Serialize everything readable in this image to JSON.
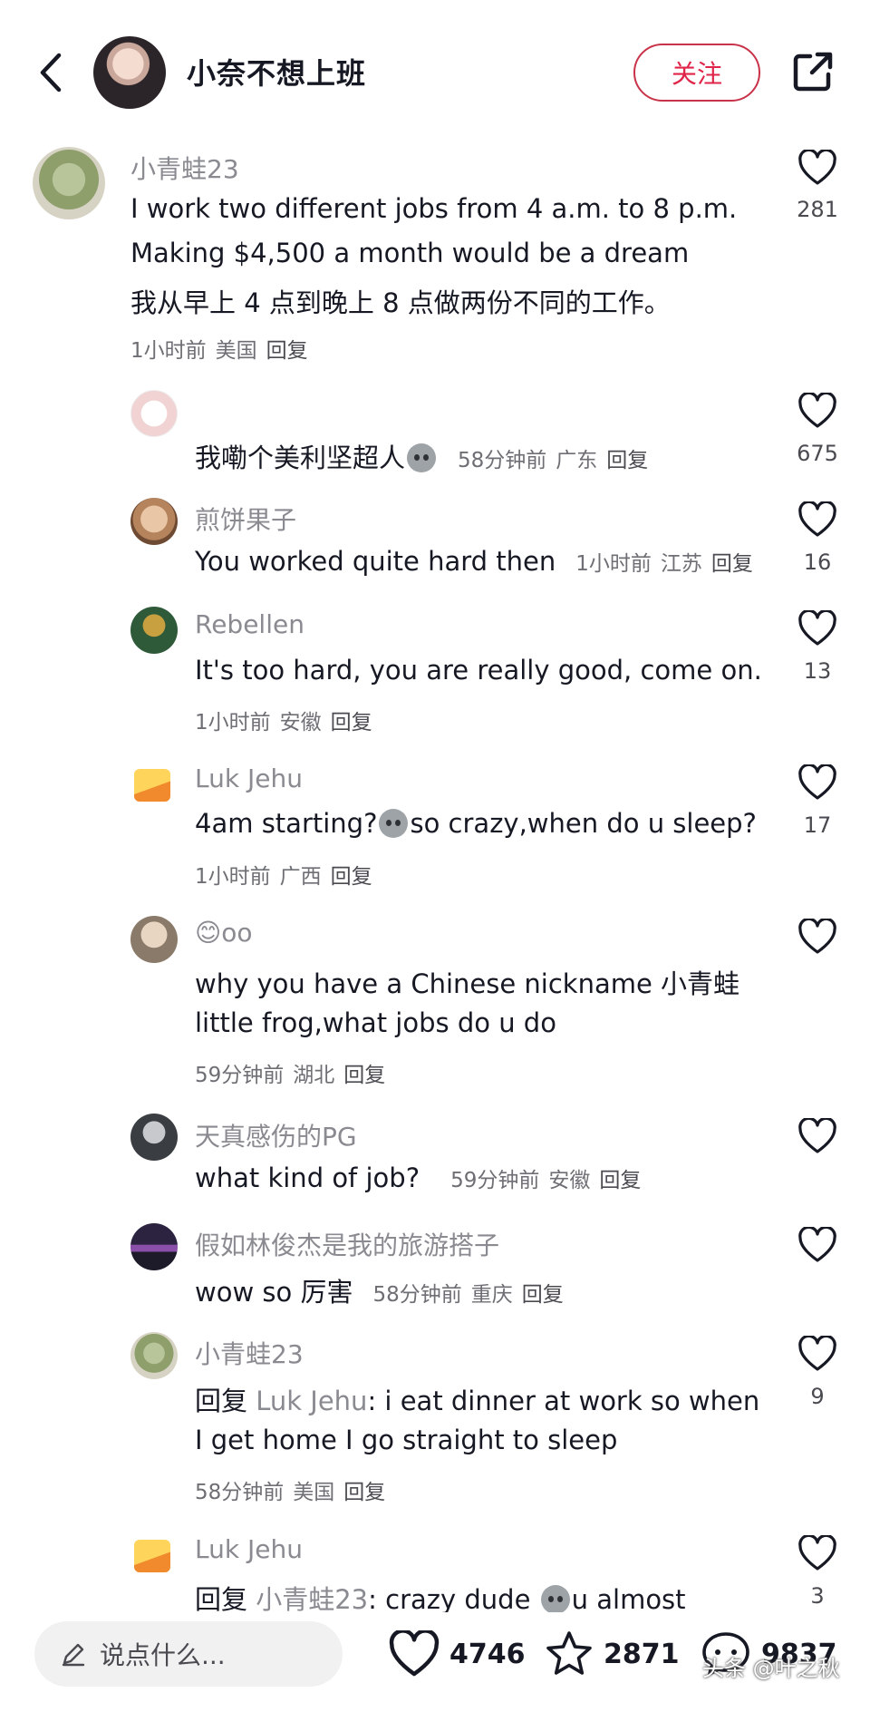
{
  "header": {
    "title": "小奈不想上班",
    "follow_label": "关注"
  },
  "comments": [
    {
      "name": "小青蛙23",
      "lines": [
        "I work two different jobs from 4 a.m. to 8 p.m.",
        "Making $4,500 a month would be a dream",
        "我从早上 4 点到晚上 8 点做两份不同的工作。"
      ],
      "time": "1小时前",
      "location": "美国",
      "reply": "回复",
      "likes": "281"
    },
    {
      "name": "",
      "text": "我嘞个美利坚超人",
      "time": "58分钟前",
      "location": "广东",
      "reply": "回复",
      "likes": "675"
    },
    {
      "name": "煎饼果子",
      "text": "You worked quite hard then",
      "time": "1小时前",
      "location": "江苏",
      "reply": "回复",
      "likes": "16"
    },
    {
      "name": "Rebellen",
      "text": "It's too hard, you are really good, come on.",
      "time": "1小时前",
      "location": "安徽",
      "reply": "回复",
      "likes": "13"
    },
    {
      "name": "Luk Jehu",
      "text_a": "4am starting?",
      "text_b": "so crazy,when do u sleep?",
      "time": "1小时前",
      "location": "广西",
      "reply": "回复",
      "likes": "17"
    },
    {
      "name": "😊oo",
      "lines": [
        "why you have a  Chinese nickname 小青蛙",
        " little frog,what jobs do u do"
      ],
      "time": "59分钟前",
      "location": "湖北",
      "reply": "回复",
      "likes": ""
    },
    {
      "name": "天真感伤的PG",
      "text": "what kind of job?",
      "time": "59分钟前",
      "location": "安徽",
      "reply": "回复",
      "likes": ""
    },
    {
      "name": "假如林俊杰是我的旅游搭子",
      "text": "wow so 厉害",
      "time": "58分钟前",
      "location": "重庆",
      "reply": "回复",
      "likes": ""
    },
    {
      "name": "小青蛙23",
      "reply_prefix": "回复",
      "reply_to": "Luk Jehu",
      "line1": ": i eat dinner at work so when",
      "line2": "I get home I go straight to sleep",
      "time": "58分钟前",
      "location": "美国",
      "reply": "回复",
      "likes": "9"
    },
    {
      "name": "Luk Jehu",
      "reply_prefix": "回复",
      "reply_to": "小青蛙23",
      "text_a": ": crazy dude",
      "text_b": "u almost",
      "likes": "3"
    }
  ],
  "bottom": {
    "input_placeholder": "说点什么...",
    "likes": "4746",
    "favorites": "2871",
    "comments": "9837",
    "watermark": "头条 @叶之秋"
  },
  "icons": {
    "back": "chevron-left-icon",
    "share": "share-external-icon",
    "like": "heart-outline-icon",
    "favorite": "star-outline-icon",
    "comment": "comment-bubble-icon",
    "edit": "pencil-icon"
  },
  "colors": {
    "accent": "#e0254a",
    "follow_border": "#c9334a",
    "text_primary": "#161823",
    "text_muted": "#8a8b91"
  }
}
